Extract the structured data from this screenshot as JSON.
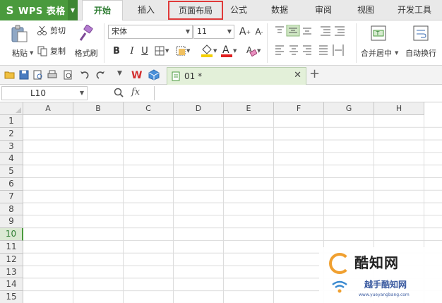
{
  "app": {
    "logo": "S",
    "title": "WPS 表格"
  },
  "tabs": [
    {
      "label": "开始",
      "state": "active"
    },
    {
      "label": "插入",
      "state": "normal"
    },
    {
      "label": "页面布局",
      "state": "highlighted"
    },
    {
      "label": "公式",
      "state": "normal"
    },
    {
      "label": "数据",
      "state": "normal"
    },
    {
      "label": "审阅",
      "state": "normal"
    },
    {
      "label": "视图",
      "state": "normal"
    },
    {
      "label": "开发工具",
      "state": "normal"
    }
  ],
  "ribbon": {
    "paste": "粘贴",
    "cut": "剪切",
    "copy": "复制",
    "format_painter": "格式刷",
    "font_name": "宋体",
    "font_size": "11",
    "bold": "B",
    "italic": "I",
    "underline": "U",
    "merge_center": "合并居中",
    "wrap_text": "自动换行"
  },
  "document": {
    "tab_label": "01 *"
  },
  "formula_bar": {
    "name_box": "L10",
    "fx": "fx"
  },
  "grid": {
    "columns": [
      "A",
      "B",
      "C",
      "D",
      "E",
      "F",
      "G",
      "H"
    ],
    "rows": [
      "1",
      "2",
      "3",
      "4",
      "5",
      "6",
      "7",
      "8",
      "9",
      "10",
      "11",
      "12",
      "13",
      "14",
      "15"
    ],
    "selected_row": "10"
  },
  "watermark": {
    "title": "酷知网",
    "subtitle": "越手酷知网",
    "url": "www.yueyangbang.com"
  },
  "colors": {
    "accent": "#4a9a3d",
    "highlight_border": "#e03a3a",
    "font_color_bar": "#e02020",
    "fill_color_bar": "#f5d000"
  }
}
